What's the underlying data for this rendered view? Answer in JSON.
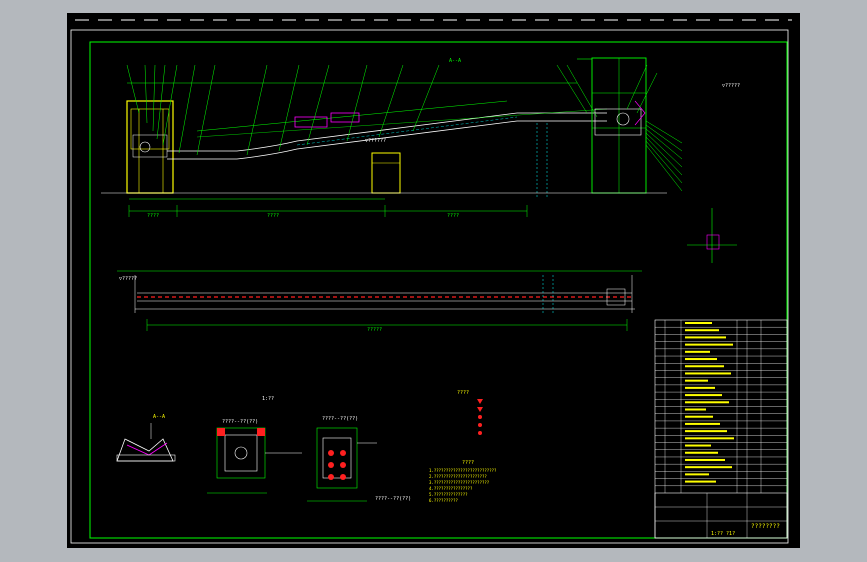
{
  "sheet": {
    "frame_color": "#00ff00",
    "background": "#000000",
    "outer_background": "#b4b8bd",
    "accent_colors": {
      "conveyor_red": "#ff2020",
      "magenta": "#ff00ff",
      "yellow": "#ffff00",
      "cyan": "#00ffff",
      "white": "#ffffff"
    }
  },
  "labels": {
    "section_marker": "A--A",
    "view_aa": "A--A",
    "elev_mid": "▽??????",
    "elev_right": "▽?????",
    "dim_left": "????",
    "dim_mid": "????",
    "dim_right": "????",
    "plan_left": "▽?????",
    "plan_length": "?????",
    "detail_title": "1:??",
    "tail_detail": "????--??(??)",
    "head_detail": "????--??(??)",
    "side_detail": "????--??(??)",
    "legend_title": "????",
    "notes_title": "????"
  },
  "notes": [
    "1.??????????????????????????",
    "2.??????????????????????",
    "3.???????????????????????",
    "4.????????????????",
    "5.??????????????",
    "6.??????????"
  ],
  "title_block": {
    "title": "????????",
    "sheet_no": "1:??  ?1?"
  }
}
